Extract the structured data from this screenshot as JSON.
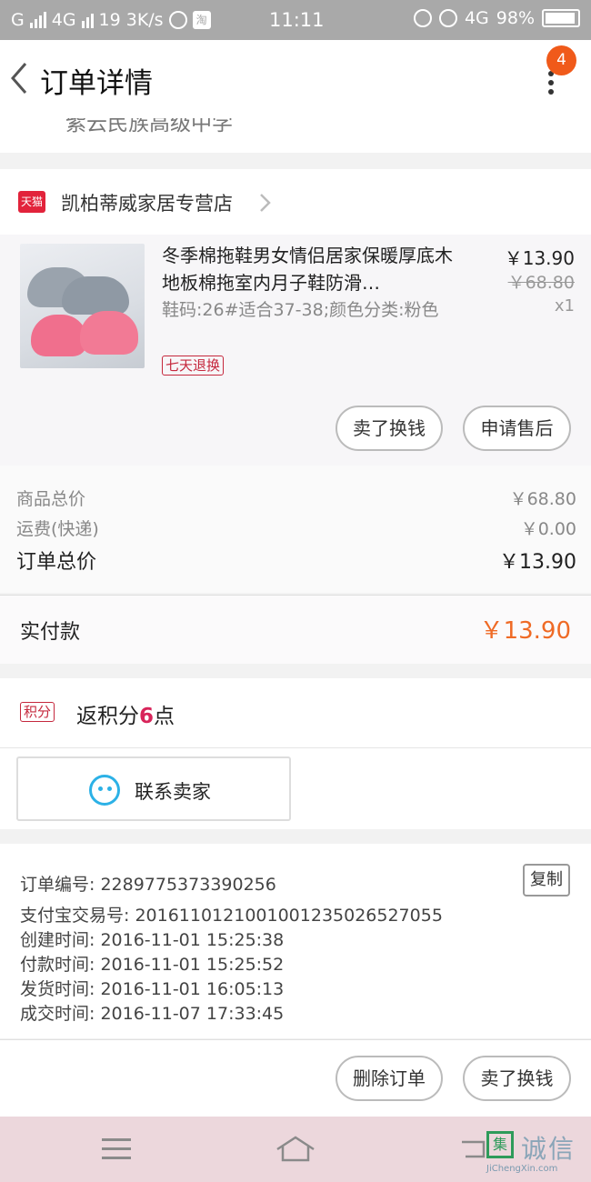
{
  "status_bar": {
    "carrier": "G",
    "network": "4G",
    "notif_count": "19",
    "speed": "3K/s",
    "taobao_icon": "淘",
    "time": "11:11",
    "network2": "4G",
    "battery": "98%"
  },
  "header": {
    "title": "订单详情",
    "badge": "4"
  },
  "address_partial": "紫云民族高级中学",
  "shop": {
    "logo_text": "天猫",
    "name": "凯柏蒂威家居专营店"
  },
  "product": {
    "title": "冬季棉拖鞋男女情侣居家保暖厚底木地板棉拖室内月子鞋防滑…",
    "sku": "鞋码:26#适合37-38;颜色分类:粉色",
    "tag": "七天退换",
    "price": "￥13.90",
    "original_price": "￥68.80",
    "qty": "x1"
  },
  "product_actions": {
    "sell": "卖了换钱",
    "after_sale": "申请售后"
  },
  "totals": {
    "goods_label": "商品总价",
    "goods_value": "￥68.80",
    "shipping_label": "运费(快递)",
    "shipping_value": "￥0.00",
    "order_label": "订单总价",
    "order_value": "￥13.90"
  },
  "paid": {
    "label": "实付款",
    "value": "￥13.90"
  },
  "points": {
    "tag": "积分",
    "prefix": "返积分",
    "count": "6",
    "suffix": "点"
  },
  "contact": {
    "label": "联系卖家"
  },
  "order_info": {
    "order_no": "订单编号: 2289775373390256",
    "copy": "复制",
    "alipay_no": "支付宝交易号: 2016110121001001235026527055",
    "created": "创建时间: 2016-11-01  15:25:38",
    "paid": "付款时间: 2016-11-01  15:25:52",
    "shipped": "发货时间: 2016-11-01  16:05:13",
    "completed": "成交时间: 2016-11-07  17:33:45"
  },
  "bottom_actions": {
    "delete": "删除订单",
    "sell": "卖了换钱"
  },
  "watermark": {
    "logo": "集",
    "text": "诚信",
    "url": "JiChengXin.com"
  }
}
